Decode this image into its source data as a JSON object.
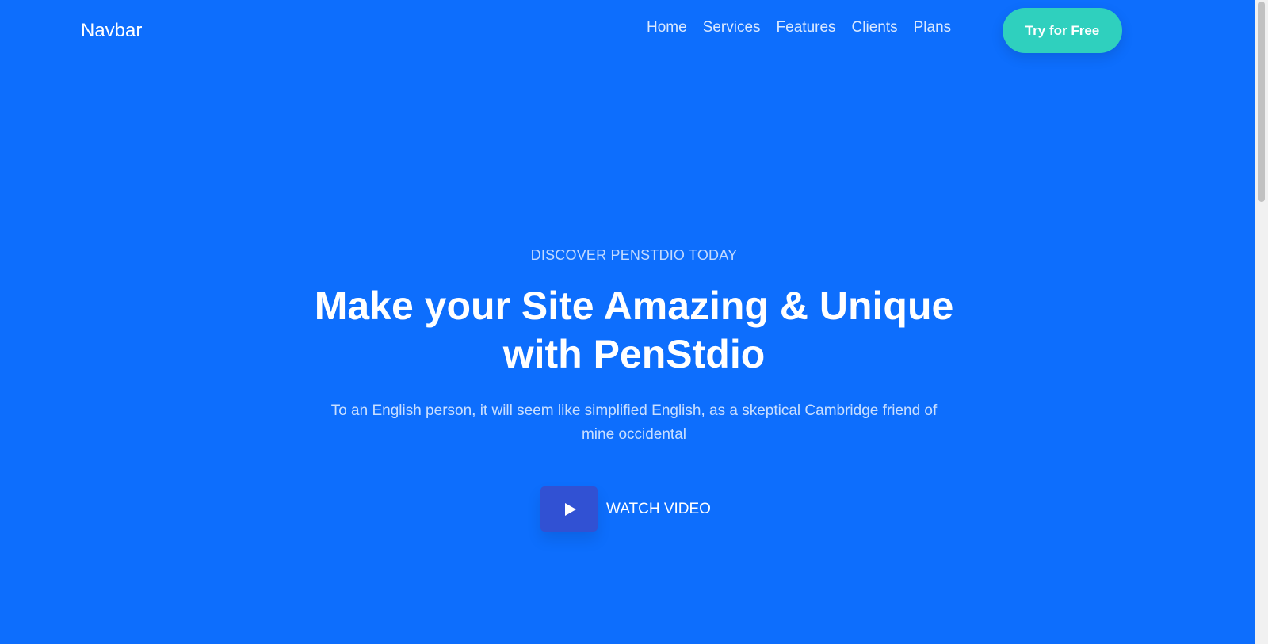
{
  "navbar": {
    "brand": "Navbar",
    "links": [
      "Home",
      "Services",
      "Features",
      "Clients",
      "Plans"
    ],
    "cta_label": "Try for Free"
  },
  "hero": {
    "eyebrow": "DISCOVER PENSTDIO TODAY",
    "headline": "Make your Site Amazing & Unique with PenStdio",
    "subtitle": "To an English person, it will seem like simplified English, as a skeptical Cambridge friend of mine occidental",
    "video_label": "WATCH VIDEO",
    "play_icon": "play-icon"
  },
  "colors": {
    "background": "#0d6efd",
    "cta": "#2fd0be",
    "play_button": "#3151d3",
    "text": "#ffffff"
  }
}
